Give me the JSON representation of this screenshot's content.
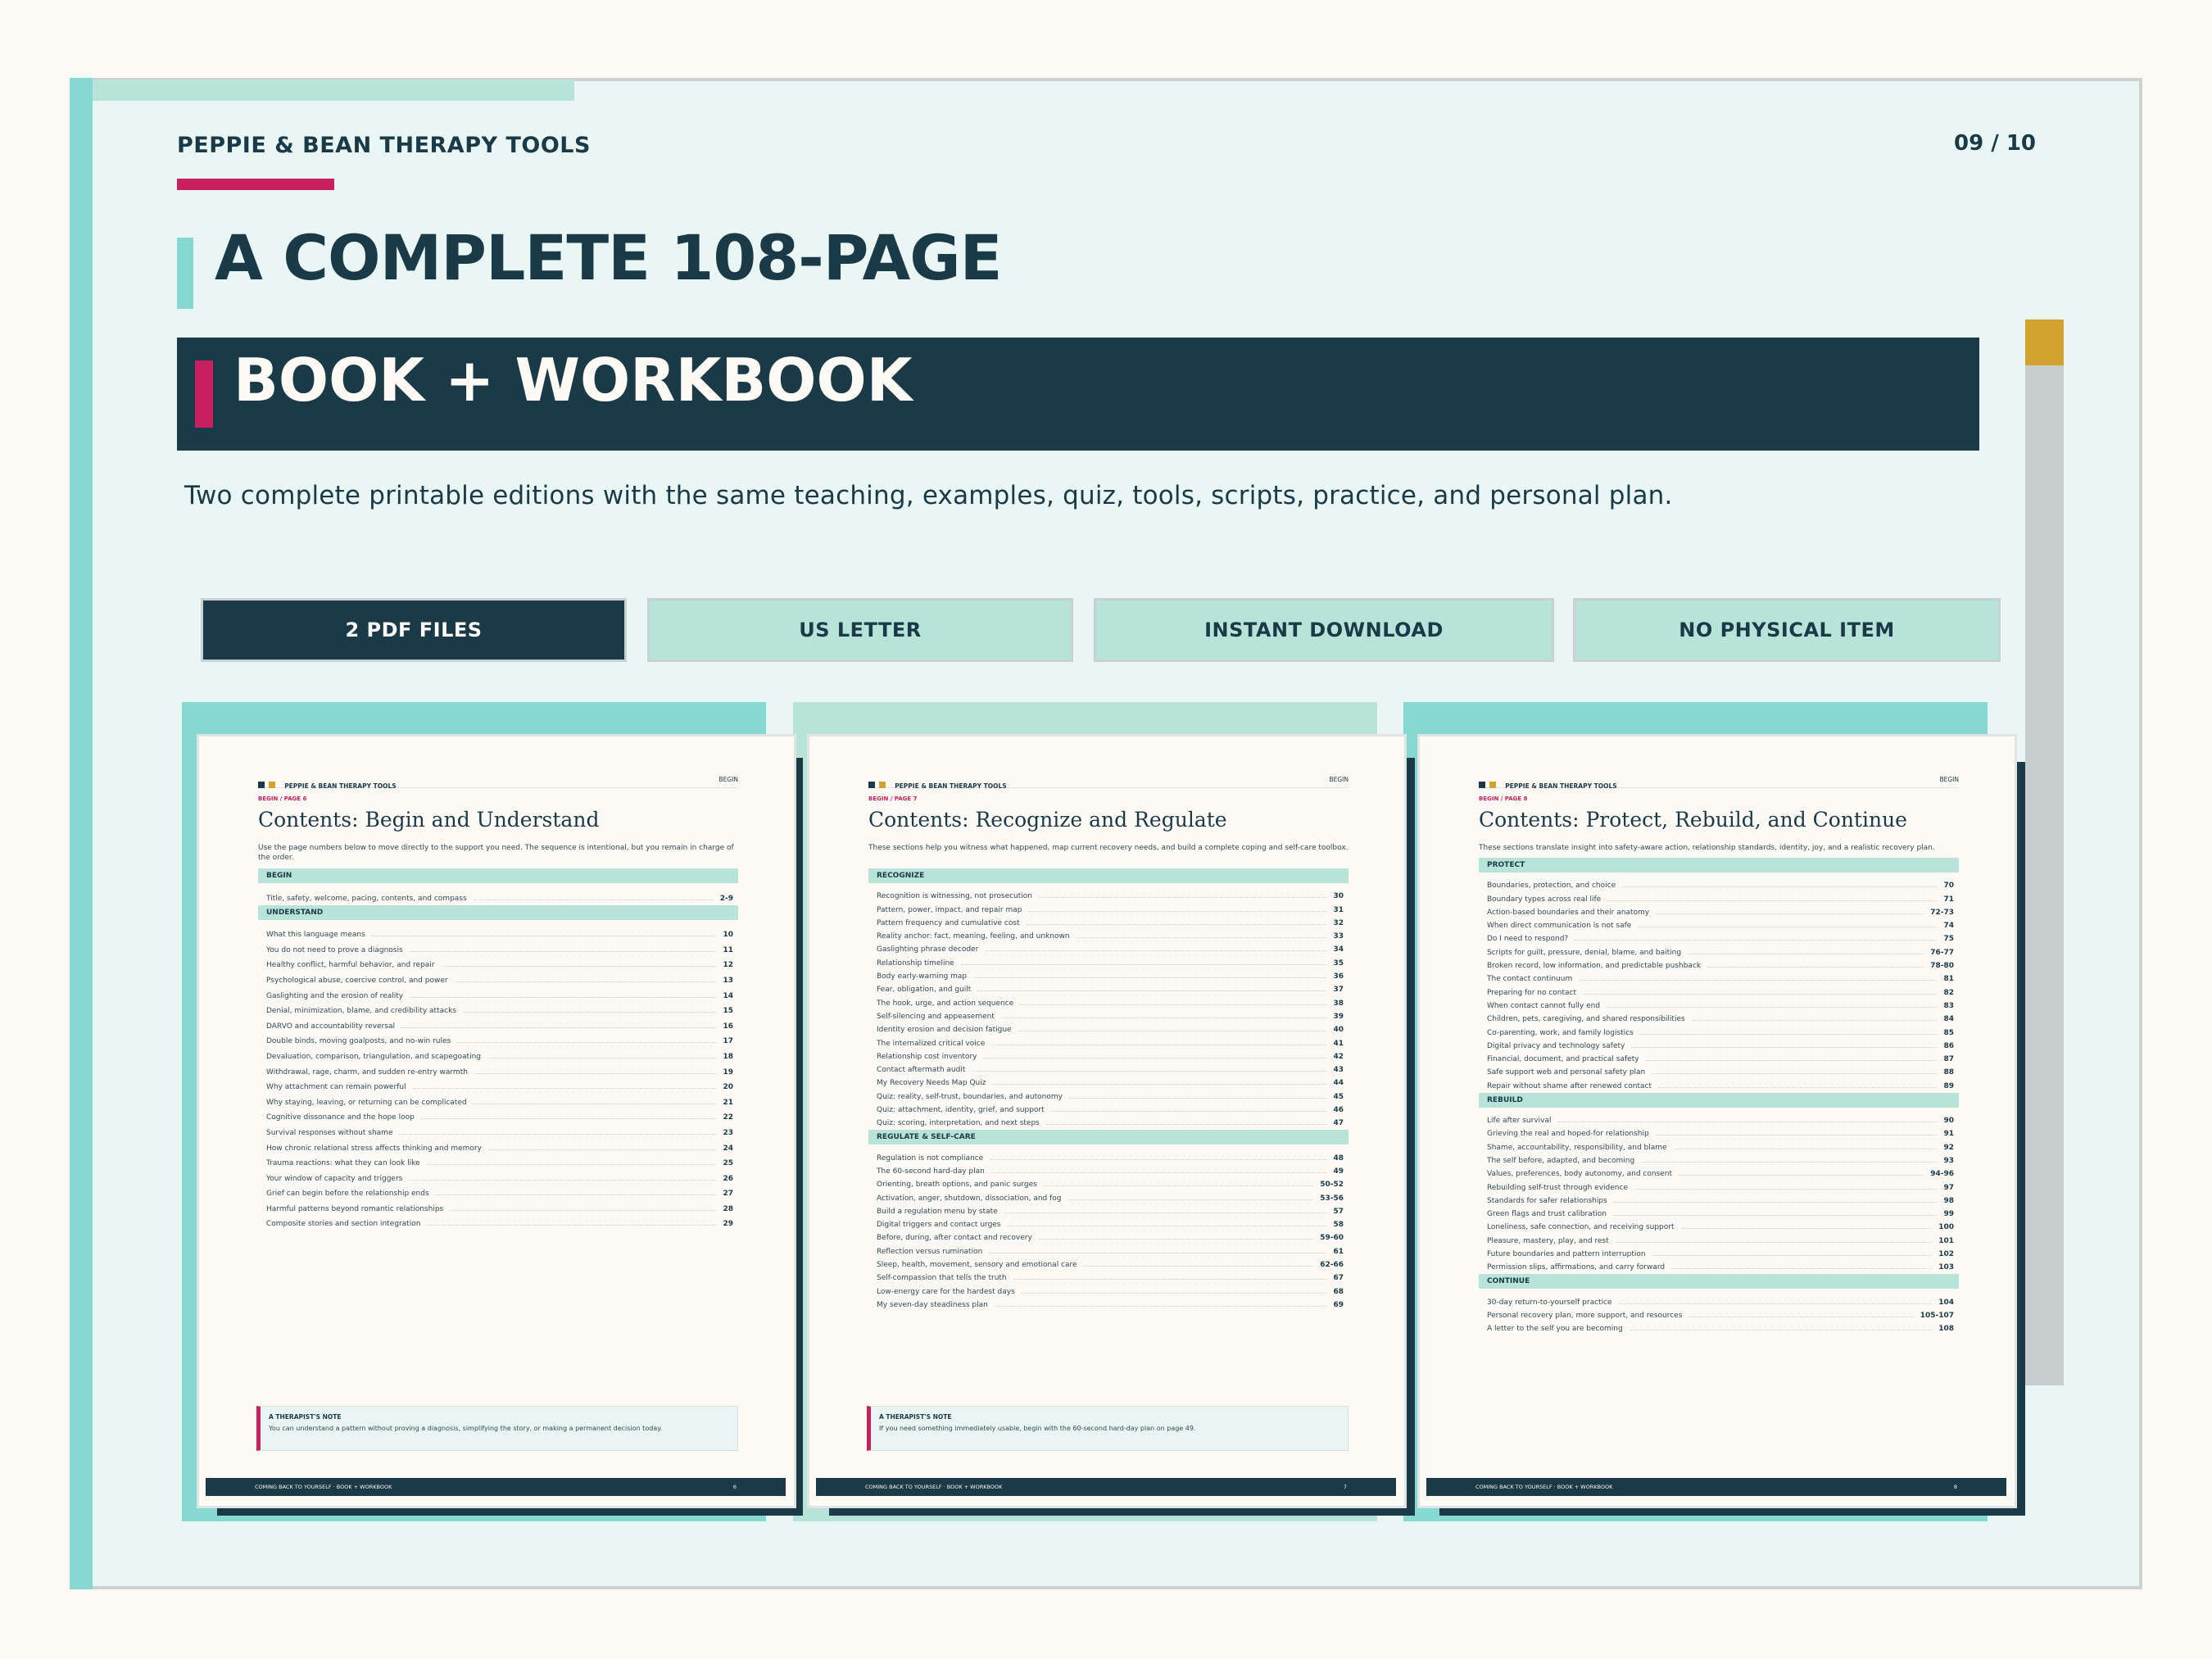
{
  "brand": "PEPPIE & BEAN THERAPY TOOLS",
  "page_indicator": "09 / 10",
  "title": "A COMPLETE 108-PAGE",
  "subtitle": "BOOK + WORKBOOK",
  "description": "Two complete printable editions with the same teaching, examples, quiz, tools, scripts, practice, and personal plan.",
  "chips": [
    "2 PDF FILES",
    "US LETTER",
    "INSTANT DOWNLOAD",
    "NO PHYSICAL ITEM"
  ],
  "pages": [
    {
      "header_brand": "PEPPIE & BEAN THERAPY TOOLS",
      "header_section": "BEGIN",
      "kicker": "BEGIN / PAGE 6",
      "heading": "Contents: Begin and Understand",
      "intro": "Use the page numbers below to move directly to the support you need. The sequence is intentional, but you remain in charge of the order.",
      "sections": [
        {
          "name": "BEGIN",
          "items": [
            {
              "t": "Title, safety, welcome, pacing, contents, and compass",
              "p": "2-9"
            }
          ]
        },
        {
          "name": "UNDERSTAND",
          "items": [
            {
              "t": "What this language means",
              "p": "10"
            },
            {
              "t": "You do not need to prove a diagnosis",
              "p": "11"
            },
            {
              "t": "Healthy conflict, harmful behavior, and repair",
              "p": "12"
            },
            {
              "t": "Psychological abuse, coercive control, and power",
              "p": "13"
            },
            {
              "t": "Gaslighting and the erosion of reality",
              "p": "14"
            },
            {
              "t": "Denial, minimization, blame, and credibility attacks",
              "p": "15"
            },
            {
              "t": "DARVO and accountability reversal",
              "p": "16"
            },
            {
              "t": "Double binds, moving goalposts, and no-win rules",
              "p": "17"
            },
            {
              "t": "Devaluation, comparison, triangulation, and scapegoating",
              "p": "18"
            },
            {
              "t": "Withdrawal, rage, charm, and sudden re-entry warmth",
              "p": "19"
            },
            {
              "t": "Why attachment can remain powerful",
              "p": "20"
            },
            {
              "t": "Why staying, leaving, or returning can be complicated",
              "p": "21"
            },
            {
              "t": "Cognitive dissonance and the hope loop",
              "p": "22"
            },
            {
              "t": "Survival responses without shame",
              "p": "23"
            },
            {
              "t": "How chronic relational stress affects thinking and memory",
              "p": "24"
            },
            {
              "t": "Trauma reactions: what they can look like",
              "p": "25"
            },
            {
              "t": "Your window of capacity and triggers",
              "p": "26"
            },
            {
              "t": "Grief can begin before the relationship ends",
              "p": "27"
            },
            {
              "t": "Harmful patterns beyond romantic relationships",
              "p": "28"
            },
            {
              "t": "Composite stories and section integration",
              "p": "29"
            }
          ]
        }
      ],
      "note_title": "A THERAPIST'S NOTE",
      "note_body": "You can understand a pattern without proving a diagnosis, simplifying the story, or making a permanent decision today.",
      "footer_left": "COMING BACK TO YOURSELF · BOOK + WORKBOOK",
      "footer_right": "6"
    },
    {
      "header_brand": "PEPPIE & BEAN THERAPY TOOLS",
      "header_section": "BEGIN",
      "kicker": "BEGIN / PAGE 7",
      "heading": "Contents: Recognize and Regulate",
      "intro": "These sections help you witness what happened, map current recovery needs, and build a complete coping and self-care toolbox.",
      "sections": [
        {
          "name": "RECOGNIZE",
          "items": [
            {
              "t": "Recognition is witnessing, not prosecution",
              "p": "30"
            },
            {
              "t": "Pattern, power, impact, and repair map",
              "p": "31"
            },
            {
              "t": "Pattern frequency and cumulative cost",
              "p": "32"
            },
            {
              "t": "Reality anchor: fact, meaning, feeling, and unknown",
              "p": "33"
            },
            {
              "t": "Gaslighting phrase decoder",
              "p": "34"
            },
            {
              "t": "Relationship timeline",
              "p": "35"
            },
            {
              "t": "Body early-warning map",
              "p": "36"
            },
            {
              "t": "Fear, obligation, and guilt",
              "p": "37"
            },
            {
              "t": "The hook, urge, and action sequence",
              "p": "38"
            },
            {
              "t": "Self-silencing and appeasement",
              "p": "39"
            },
            {
              "t": "Identity erosion and decision fatigue",
              "p": "40"
            },
            {
              "t": "The internalized critical voice",
              "p": "41"
            },
            {
              "t": "Relationship cost inventory",
              "p": "42"
            },
            {
              "t": "Contact aftermath audit",
              "p": "43"
            },
            {
              "t": "My Recovery Needs Map Quiz",
              "p": "44"
            },
            {
              "t": "Quiz: reality, self-trust, boundaries, and autonomy",
              "p": "45"
            },
            {
              "t": "Quiz: attachment, identity, grief, and support",
              "p": "46"
            },
            {
              "t": "Quiz: scoring, interpretation, and next steps",
              "p": "47"
            }
          ]
        },
        {
          "name": "REGULATE & SELF-CARE",
          "items": [
            {
              "t": "Regulation is not compliance",
              "p": "48"
            },
            {
              "t": "The 60-second hard-day plan",
              "p": "49"
            },
            {
              "t": "Orienting, breath options, and panic surges",
              "p": "50-52"
            },
            {
              "t": "Activation, anger, shutdown, dissociation, and fog",
              "p": "53-56"
            },
            {
              "t": "Build a regulation menu by state",
              "p": "57"
            },
            {
              "t": "Digital triggers and contact urges",
              "p": "58"
            },
            {
              "t": "Before, during, after contact and recovery",
              "p": "59-60"
            },
            {
              "t": "Reflection versus rumination",
              "p": "61"
            },
            {
              "t": "Sleep, health, movement, sensory and emotional care",
              "p": "62-66"
            },
            {
              "t": "Self-compassion that tells the truth",
              "p": "67"
            },
            {
              "t": "Low-energy care for the hardest days",
              "p": "68"
            },
            {
              "t": "My seven-day steadiness plan",
              "p": "69"
            }
          ]
        }
      ],
      "note_title": "A THERAPIST'S NOTE",
      "note_body": "If you need something immediately usable, begin with the 60-second hard-day plan on page 49.",
      "footer_left": "COMING BACK TO YOURSELF · BOOK + WORKBOOK",
      "footer_right": "7"
    },
    {
      "header_brand": "PEPPIE & BEAN THERAPY TOOLS",
      "header_section": "BEGIN",
      "kicker": "BEGIN / PAGE 8",
      "heading": "Contents: Protect, Rebuild, and Continue",
      "intro": "These sections translate insight into safety-aware action, relationship standards, identity, joy, and a realistic recovery plan.",
      "sections": [
        {
          "name": "PROTECT",
          "items": [
            {
              "t": "Boundaries, protection, and choice",
              "p": "70"
            },
            {
              "t": "Boundary types across real life",
              "p": "71"
            },
            {
              "t": "Action-based boundaries and their anatomy",
              "p": "72-73"
            },
            {
              "t": "When direct communication is not safe",
              "p": "74"
            },
            {
              "t": "Do I need to respond?",
              "p": "75"
            },
            {
              "t": "Scripts for guilt, pressure, denial, blame, and baiting",
              "p": "76-77"
            },
            {
              "t": "Broken record, low information, and predictable pushback",
              "p": "78-80"
            },
            {
              "t": "The contact continuum",
              "p": "81"
            },
            {
              "t": "Preparing for no contact",
              "p": "82"
            },
            {
              "t": "When contact cannot fully end",
              "p": "83"
            },
            {
              "t": "Children, pets, caregiving, and shared responsibilities",
              "p": "84"
            },
            {
              "t": "Co-parenting, work, and family logistics",
              "p": "85"
            },
            {
              "t": "Digital privacy and technology safety",
              "p": "86"
            },
            {
              "t": "Financial, document, and practical safety",
              "p": "87"
            },
            {
              "t": "Safe support web and personal safety plan",
              "p": "88"
            },
            {
              "t": "Repair without shame after renewed contact",
              "p": "89"
            }
          ]
        },
        {
          "name": "REBUILD",
          "items": [
            {
              "t": "Life after survival",
              "p": "90"
            },
            {
              "t": "Grieving the real and hoped-for relationship",
              "p": "91"
            },
            {
              "t": "Shame, accountability, responsibility, and blame",
              "p": "92"
            },
            {
              "t": "The self before, adapted, and becoming",
              "p": "93"
            },
            {
              "t": "Values, preferences, body autonomy, and consent",
              "p": "94-96"
            },
            {
              "t": "Rebuilding self-trust through evidence",
              "p": "97"
            },
            {
              "t": "Standards for safer relationships",
              "p": "98"
            },
            {
              "t": "Green flags and trust calibration",
              "p": "99"
            },
            {
              "t": "Loneliness, safe connection, and receiving support",
              "p": "100"
            },
            {
              "t": "Pleasure, mastery, play, and rest",
              "p": "101"
            },
            {
              "t": "Future boundaries and pattern interruption",
              "p": "102"
            },
            {
              "t": "Permission slips, affirmations, and carry forward",
              "p": "103"
            }
          ]
        },
        {
          "name": "CONTINUE",
          "items": [
            {
              "t": "30-day return-to-yourself practice",
              "p": "104"
            },
            {
              "t": "Personal recovery plan, more support, and resources",
              "p": "105-107"
            },
            {
              "t": "A letter to the self you are becoming",
              "p": "108"
            }
          ]
        }
      ],
      "note_title": "",
      "note_body": "",
      "footer_left": "COMING BACK TO YOURSELF · BOOK + WORKBOOK",
      "footer_right": "8"
    }
  ],
  "colors": {
    "navy": "#1a3a47",
    "teal": "#85d9d1",
    "mint": "#b8e3d8",
    "magenta": "#c8205e",
    "gold": "#d2a12e",
    "cream": "#fdf9f4",
    "slide_bg": "#e9f6f3"
  }
}
